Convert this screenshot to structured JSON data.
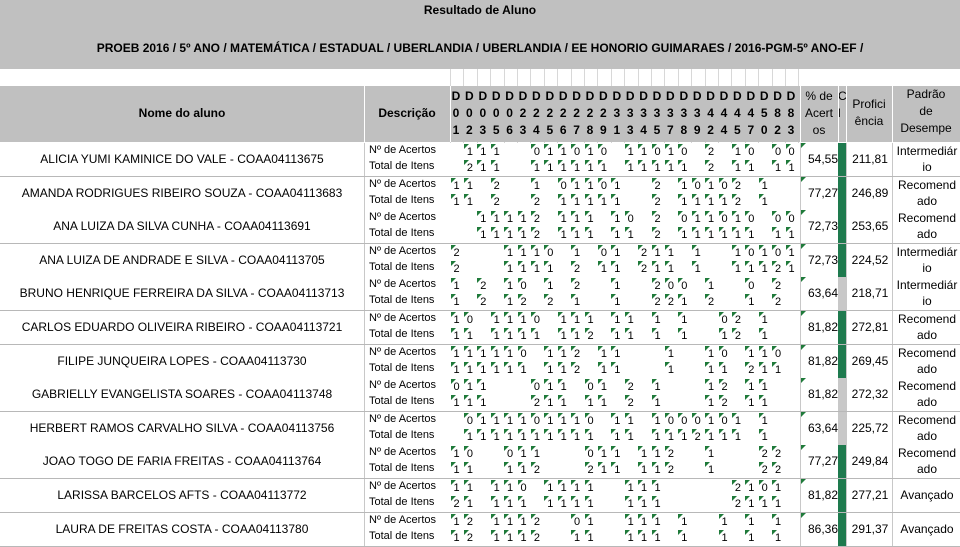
{
  "report": {
    "title": "Resultado de Aluno",
    "subtitle": "PROEB 2016 / 5º ANO / MATEMÁTICA / ESTADUAL / UBERLANDIA / UBERLANDIA / EE HONORIO GUIMARAES / 2016-PGM-5º ANO-EF /"
  },
  "columns": {
    "name": "Nome do aluno",
    "description": "Descrição",
    "pct_lines": [
      "% de",
      "Acert",
      "os"
    ],
    "c_lines": [
      "C",
      "l"
    ],
    "prof_lines": [
      "Profici",
      "ência"
    ],
    "pad_lines": [
      "Padrão",
      "de",
      "Desempe"
    ],
    "item_codes": [
      [
        "D",
        "0",
        "1"
      ],
      [
        "D",
        "0",
        "2"
      ],
      [
        "D",
        "0",
        "3"
      ],
      [
        "D",
        "0",
        "5"
      ],
      [
        "D",
        "0",
        "6"
      ],
      [
        "D",
        "2",
        "3"
      ],
      [
        "D",
        "2",
        "4"
      ],
      [
        "D",
        "2",
        "5"
      ],
      [
        "D",
        "2",
        "6"
      ],
      [
        "D",
        "2",
        "7"
      ],
      [
        "D",
        "2",
        "8"
      ],
      [
        "D",
        "2",
        "9"
      ],
      [
        "D",
        "3",
        "1"
      ],
      [
        "D",
        "3",
        "3"
      ],
      [
        "D",
        "3",
        "4"
      ],
      [
        "D",
        "3",
        "5"
      ],
      [
        "D",
        "3",
        "7"
      ],
      [
        "D",
        "3",
        "8"
      ],
      [
        "D",
        "3",
        "9"
      ],
      [
        "D",
        "4",
        "2"
      ],
      [
        "D",
        "4",
        "4"
      ],
      [
        "D",
        "4",
        "5"
      ],
      [
        "D",
        "4",
        "7"
      ],
      [
        "D",
        "5",
        "0"
      ],
      [
        "D",
        "8",
        "2"
      ],
      [
        "D",
        "8",
        "3"
      ]
    ]
  },
  "labels": {
    "acertos": "Nº de Acertos",
    "total": "Total de Itens"
  },
  "colors": {
    "header_bg": "#c0c0c0",
    "mark": "#1f7a3a",
    "bar_green": "#1e7a4e",
    "bar_gray": "#c8c8c8"
  },
  "students": [
    {
      "name": "ALICIA YUMI KAMINICE DO VALE - COAA04113675",
      "acertos": [
        "",
        "1",
        "1",
        "1",
        "",
        "",
        "0",
        "1",
        "1",
        "0",
        "1",
        "0",
        "",
        "1",
        "1",
        "0",
        "1",
        "0",
        "",
        "2",
        "",
        "1",
        "0",
        "",
        "0",
        "0",
        "1"
      ],
      "total": [
        "",
        "2",
        "1",
        "1",
        "",
        "",
        "1",
        "1",
        "1",
        "1",
        "1",
        "1",
        "",
        "1",
        "1",
        "1",
        "1",
        "1",
        "",
        "2",
        "",
        "1",
        "1",
        "",
        "1",
        "1",
        "1"
      ],
      "pct": "54,55",
      "prof": "211,81",
      "pad": [
        "Intermediár",
        "io"
      ],
      "bar": "green"
    },
    {
      "name": "AMANDA RODRIGUES RIBEIRO SOUZA - COAA04113683",
      "acertos": [
        "1",
        "1",
        "",
        "2",
        "",
        "",
        "1",
        "",
        "0",
        "1",
        "1",
        "0",
        "1",
        "",
        "",
        "2",
        "",
        "1",
        "0",
        "1",
        "0",
        "2",
        "",
        "1"
      ],
      "total": [
        "1",
        "1",
        "",
        "2",
        "",
        "",
        "2",
        "",
        "1",
        "1",
        "1",
        "1",
        "1",
        "",
        "",
        "2",
        "",
        "1",
        "1",
        "1",
        "1",
        "2",
        "",
        "1"
      ],
      "pct": "77,27",
      "prof": "246,89",
      "pad": [
        "Recomend",
        "ado"
      ],
      "bar": "green"
    },
    {
      "name": "ANA LUIZA DA SILVA CUNHA - COAA04113691",
      "acertos": [
        "",
        "",
        "1",
        "1",
        "1",
        "1",
        "2",
        "",
        "1",
        "1",
        "1",
        "",
        "1",
        "0",
        "",
        "2",
        "",
        "0",
        "1",
        "1",
        "0",
        "1",
        "0",
        "",
        "0",
        "0",
        "1"
      ],
      "total": [
        "",
        "",
        "1",
        "1",
        "1",
        "1",
        "2",
        "",
        "1",
        "1",
        "1",
        "",
        "1",
        "1",
        "",
        "2",
        "",
        "1",
        "1",
        "1",
        "1",
        "1",
        "1",
        "",
        "1",
        "1",
        "1"
      ],
      "pct": "72,73",
      "prof": "253,65",
      "pad": [
        "Recomend",
        "ado"
      ],
      "bar": "green"
    },
    {
      "name": "ANA LUIZA DE ANDRADE E SILVA - COAA04113705",
      "acertos": [
        "2",
        "",
        "",
        "",
        "1",
        "1",
        "1",
        "0",
        "",
        "1",
        "",
        "0",
        "1",
        "",
        "2",
        "1",
        "1",
        "",
        "1",
        "",
        "",
        "1",
        "0",
        "1",
        "0",
        "1"
      ],
      "total": [
        "2",
        "",
        "",
        "",
        "1",
        "1",
        "1",
        "1",
        "",
        "2",
        "",
        "1",
        "1",
        "",
        "2",
        "1",
        "1",
        "",
        "1",
        "",
        "",
        "1",
        "1",
        "1",
        "2",
        "1"
      ],
      "pct": "72,73",
      "prof": "224,52",
      "pad": [
        "Intermediár",
        "io"
      ],
      "bar": "green"
    },
    {
      "name": "BRUNO HENRIQUE FERREIRA DA SILVA - COAA04113713",
      "acertos": [
        "1",
        "",
        "2",
        "",
        "1",
        "0",
        "",
        "1",
        "",
        "2",
        "",
        "",
        "1",
        "",
        "",
        "2",
        "0",
        "0",
        "",
        "1",
        "",
        "",
        "0",
        "",
        "2"
      ],
      "total": [
        "1",
        "",
        "2",
        "",
        "1",
        "2",
        "",
        "2",
        "",
        "1",
        "",
        "",
        "1",
        "",
        "",
        "2",
        "2",
        "1",
        "",
        "2",
        "",
        "",
        "1",
        "",
        "2"
      ],
      "pct": "63,64",
      "prof": "218,71",
      "pad": [
        "Intermediár",
        "io"
      ],
      "bar": "gray"
    },
    {
      "name": "CARLOS EDUARDO OLIVEIRA RIBEIRO - COAA04113721",
      "acertos": [
        "1",
        "0",
        "",
        "1",
        "1",
        "1",
        "0",
        "",
        "1",
        "1",
        "1",
        "",
        "1",
        "1",
        "",
        "1",
        "",
        "1",
        "",
        "",
        "0",
        "2",
        "",
        "1"
      ],
      "total": [
        "1",
        "1",
        "",
        "1",
        "1",
        "1",
        "1",
        "",
        "1",
        "1",
        "2",
        "",
        "1",
        "1",
        "",
        "1",
        "",
        "1",
        "",
        "",
        "1",
        "2",
        "",
        "1"
      ],
      "pct": "81,82",
      "prof": "272,81",
      "pad": [
        "Recomend",
        "ado"
      ],
      "bar": "green"
    },
    {
      "name": "FILIPE JUNQUEIRA LOPES - COAA04113730",
      "acertos": [
        "1",
        "1",
        "1",
        "1",
        "1",
        "0",
        "",
        "1",
        "1",
        "2",
        "",
        "1",
        "1",
        "",
        "",
        "",
        "1",
        "",
        "",
        "1",
        "0",
        "",
        "1",
        "1",
        "0"
      ],
      "total": [
        "1",
        "1",
        "1",
        "1",
        "1",
        "1",
        "",
        "1",
        "1",
        "2",
        "",
        "1",
        "1",
        "",
        "",
        "",
        "1",
        "",
        "",
        "1",
        "1",
        "",
        "2",
        "1",
        "1"
      ],
      "pct": "81,82",
      "prof": "269,45",
      "pad": [
        "Recomend",
        "ado"
      ],
      "bar": "green"
    },
    {
      "name": "GABRIELLY EVANGELISTA SOARES - COAA04113748",
      "acertos": [
        "0",
        "1",
        "1",
        "",
        "",
        "",
        "0",
        "1",
        "1",
        "",
        "0",
        "1",
        "",
        "2",
        "",
        "1",
        "",
        "",
        "",
        "1",
        "2",
        "",
        "1",
        "1"
      ],
      "total": [
        "1",
        "1",
        "1",
        "",
        "",
        "",
        "2",
        "1",
        "1",
        "",
        "1",
        "1",
        "",
        "2",
        "",
        "1",
        "",
        "",
        "",
        "1",
        "2",
        "",
        "1",
        "1"
      ],
      "pct": "81,82",
      "prof": "272,32",
      "pad": [
        "Recomend",
        "ado"
      ],
      "bar": "gray"
    },
    {
      "name": "HERBERT RAMOS CARVALHO SILVA - COAA04113756",
      "acertos": [
        "",
        "0",
        "1",
        "1",
        "1",
        "1",
        "0",
        "1",
        "1",
        "1",
        "0",
        "",
        "1",
        "1",
        "",
        "1",
        "0",
        "0",
        "0",
        "1",
        "0",
        "1",
        "",
        "1"
      ],
      "total": [
        "",
        "1",
        "1",
        "1",
        "1",
        "1",
        "1",
        "1",
        "1",
        "1",
        "1",
        "",
        "1",
        "1",
        "",
        "1",
        "1",
        "1",
        "2",
        "1",
        "1",
        "1",
        "",
        "1"
      ],
      "pct": "63,64",
      "prof": "225,72",
      "pad": [
        "Recomend",
        "ado"
      ],
      "bar": "gray"
    },
    {
      "name": "JOAO TOGO DE FARIA FREITAS - COAA04113764",
      "acertos": [
        "1",
        "0",
        "",
        "",
        "0",
        "1",
        "1",
        "",
        "",
        "",
        "0",
        "1",
        "1",
        "",
        "1",
        "1",
        "2",
        "",
        "",
        "1",
        "",
        "",
        "",
        "2",
        "2"
      ],
      "total": [
        "1",
        "1",
        "",
        "",
        "1",
        "1",
        "2",
        "",
        "",
        "",
        "2",
        "1",
        "1",
        "",
        "1",
        "1",
        "2",
        "",
        "",
        "1",
        "",
        "",
        "",
        "2",
        "2"
      ],
      "pct": "77,27",
      "prof": "249,84",
      "pad": [
        "Recomend",
        "ado"
      ],
      "bar": "green"
    },
    {
      "name": "LARISSA BARCELOS AFTS - COAA04113772",
      "acertos": [
        "1",
        "1",
        "",
        "1",
        "1",
        "0",
        "",
        "1",
        "1",
        "1",
        "1",
        "",
        "",
        "1",
        "1",
        "1",
        "",
        "",
        "",
        "",
        "",
        "2",
        "1",
        "0",
        "1"
      ],
      "total": [
        "2",
        "1",
        "",
        "1",
        "1",
        "1",
        "",
        "1",
        "1",
        "1",
        "1",
        "",
        "",
        "1",
        "1",
        "1",
        "",
        "",
        "",
        "",
        "",
        "2",
        "1",
        "1",
        "1"
      ],
      "pct": "81,82",
      "prof": "277,21",
      "pad": [
        "Avançado"
      ],
      "bar": "green"
    },
    {
      "name": "LAURA DE FREITAS COSTA - COAA04113780",
      "acertos": [
        "1",
        "2",
        "",
        "1",
        "1",
        "1",
        "2",
        "",
        "",
        "0",
        "1",
        "",
        "",
        "1",
        "1",
        "1",
        "",
        "1",
        "",
        "",
        "1",
        "",
        "1",
        "",
        "1",
        "",
        "2"
      ],
      "total": [
        "1",
        "2",
        "",
        "1",
        "1",
        "1",
        "2",
        "",
        "",
        "1",
        "1",
        "",
        "",
        "1",
        "1",
        "1",
        "",
        "1",
        "",
        "",
        "1",
        "",
        "1",
        "",
        "1",
        "",
        "2"
      ],
      "pct": "86,36",
      "prof": "291,37",
      "pad": [
        "Avançado"
      ],
      "bar": "green"
    }
  ]
}
